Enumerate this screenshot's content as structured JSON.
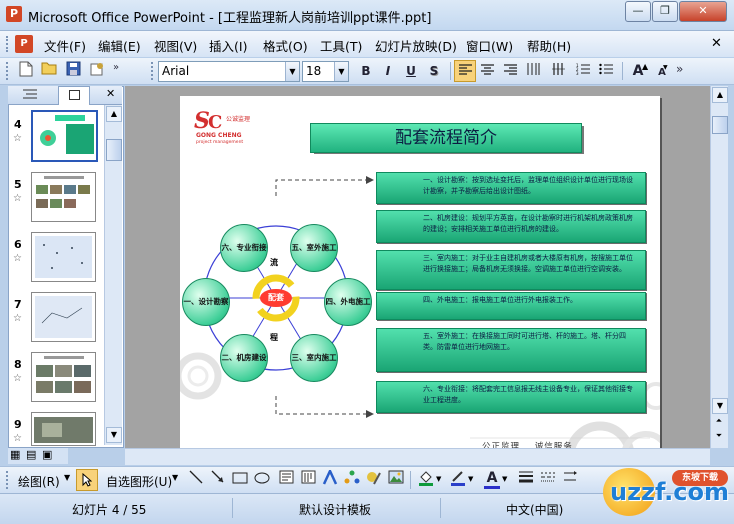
{
  "window": {
    "title": "Microsoft Office PowerPoint - [工程监理新人岗前培训ppt课件.ppt]",
    "min_label": "—",
    "restore_label": "❐",
    "close_label": "✕"
  },
  "menu": {
    "items": [
      "文件(F)",
      "编辑(E)",
      "视图(V)",
      "插入(I)",
      "格式(O)",
      "工具(T)",
      "幻灯片放映(D)",
      "窗口(W)",
      "帮助(H)"
    ],
    "close_doc": "✕"
  },
  "format_toolbar": {
    "font": "Arial",
    "size": "18",
    "bold": "B",
    "italic": "I",
    "underline": "U",
    "shadow": "S",
    "grow_font": "A",
    "shrink_font": "A"
  },
  "slides_pane": {
    "thumbnails": [
      {
        "num": "4"
      },
      {
        "num": "5"
      },
      {
        "num": "6"
      },
      {
        "num": "7"
      },
      {
        "num": "8"
      },
      {
        "num": "9"
      }
    ]
  },
  "slide": {
    "logo_brand": "GONG CHENG",
    "logo_sub": "project management",
    "logo_cn": "公诚监理",
    "title": "配套流程简介",
    "center_label": "配套",
    "flow_top": "流",
    "flow_bottom": "程",
    "circles": [
      "一、设计勘察",
      "二、机房建设",
      "三、室内施工",
      "四、外电施工",
      "五、室外施工",
      "六、专业衔接"
    ],
    "steps": [
      "一、设计勘察：按到选址变托后，监理单位组织设计单位进行现场设计勘察，并予勘察后给出设计图纸。",
      "二、机房建设：规划平方英亩，在设计勘察时进行机架机房政策机房的建设；安排相关施工单位进行机房的建设。",
      "三、室内施工：对于业主自建机房或者大楼原有机房，按搜施工单位进行换接施工；局备机房无须换接。空调施工单位进行空调安装。",
      "四、外电施工：报电施工单位进行外电报装工作。",
      "五、室外施工：在换接施工同时可进行塔、杆的施工。塔、杆分四类。防雷单位进行地网施工。",
      "六、专业衔接：将配套完工信息报无线主设备专业，保证其他衔接专业工程进度。"
    ],
    "footer": "公正监理    诚信服务"
  },
  "view_buttons": [
    "▦",
    "▤",
    "▣"
  ],
  "draw_toolbar": {
    "draw_label": "绘图(R)",
    "autoshape_label": "自选图形(U)"
  },
  "status": {
    "slide_counter": "幻灯片 4 / 55",
    "template": "默认设计模板",
    "language": "中文(中国)"
  },
  "watermark": {
    "text": "uzzf.com",
    "badge": "东坡下载"
  },
  "colors": {
    "accent_green": "#1aa574",
    "title_bg": "#2bd39b",
    "window_blue": "#c3d8f0"
  }
}
